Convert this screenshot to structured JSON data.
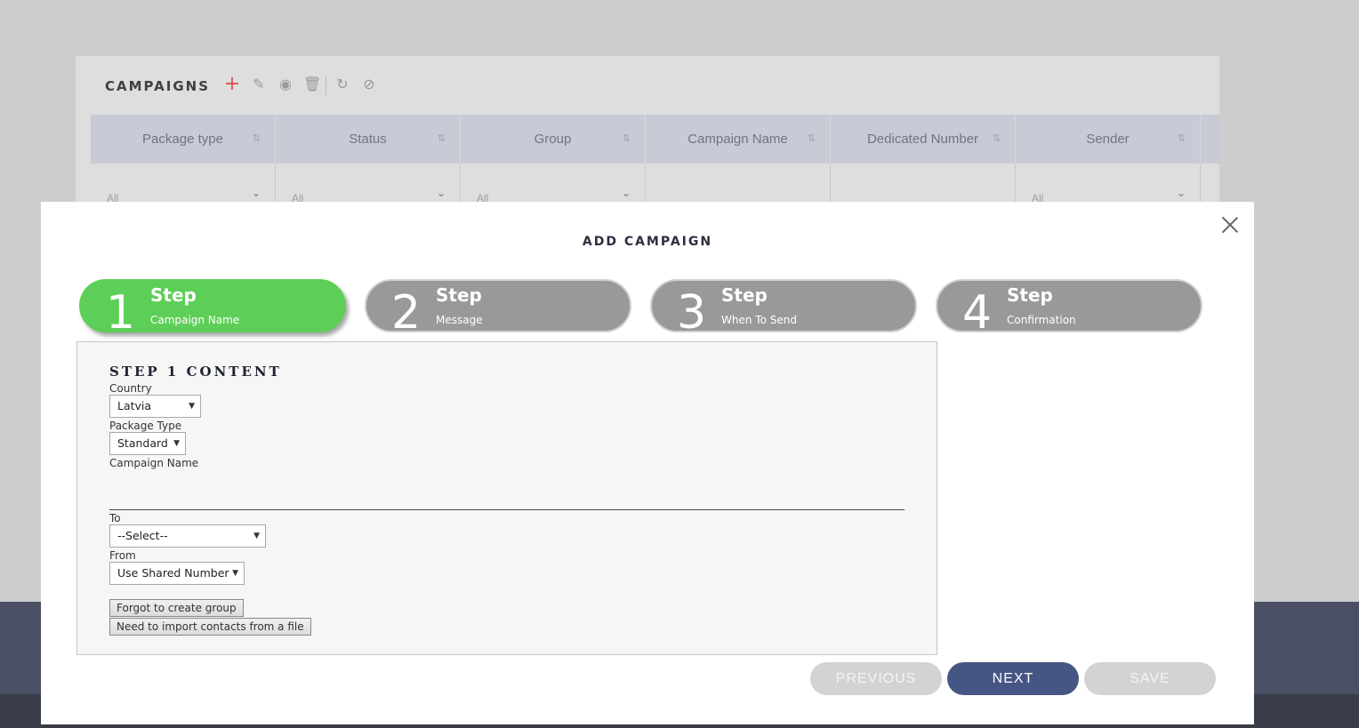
{
  "background": {
    "panel_title": "CAMPAIGNS",
    "toolbar_icons": [
      "add-icon",
      "edit-icon",
      "view-icon",
      "delete-icon",
      "refresh-icon",
      "block-icon"
    ],
    "columns": [
      {
        "label": "Package type",
        "filter": "All"
      },
      {
        "label": "Status",
        "filter": "All"
      },
      {
        "label": "Group",
        "filter": "All"
      },
      {
        "label": "Campaign Name",
        "filter": ""
      },
      {
        "label": "Dedicated Number",
        "filter": ""
      },
      {
        "label": "Sender",
        "filter": "All"
      }
    ]
  },
  "modal": {
    "title": "ADD CAMPAIGN",
    "steps": [
      {
        "num": "1",
        "label": "Step",
        "sub": "Campaign Name",
        "active": true
      },
      {
        "num": "2",
        "label": "Step",
        "sub": "Message",
        "active": false
      },
      {
        "num": "3",
        "label": "Step",
        "sub": "When To Send",
        "active": false
      },
      {
        "num": "4",
        "label": "Step",
        "sub": "Confirmation",
        "active": false
      }
    ],
    "content": {
      "title": "STEP 1 CONTENT",
      "country_label": "Country",
      "country_value": "Latvia",
      "package_label": "Package Type",
      "package_value": "Standard",
      "campaign_name_label": "Campaign Name",
      "campaign_name_value": "",
      "to_label": "To",
      "to_value": "--Select--",
      "from_label": "From",
      "from_value": "Use Shared Number",
      "forgot_group_button": "Forgot to create group",
      "import_contacts_button": "Need to import contacts from a file"
    },
    "buttons": {
      "previous": "PREVIOUS",
      "next": "NEXT",
      "save": "SAVE"
    }
  },
  "colors": {
    "active_step": "#5dce57",
    "inactive_step": "#999999",
    "next_button": "#465684",
    "disabled_button": "#d3d3d3"
  }
}
